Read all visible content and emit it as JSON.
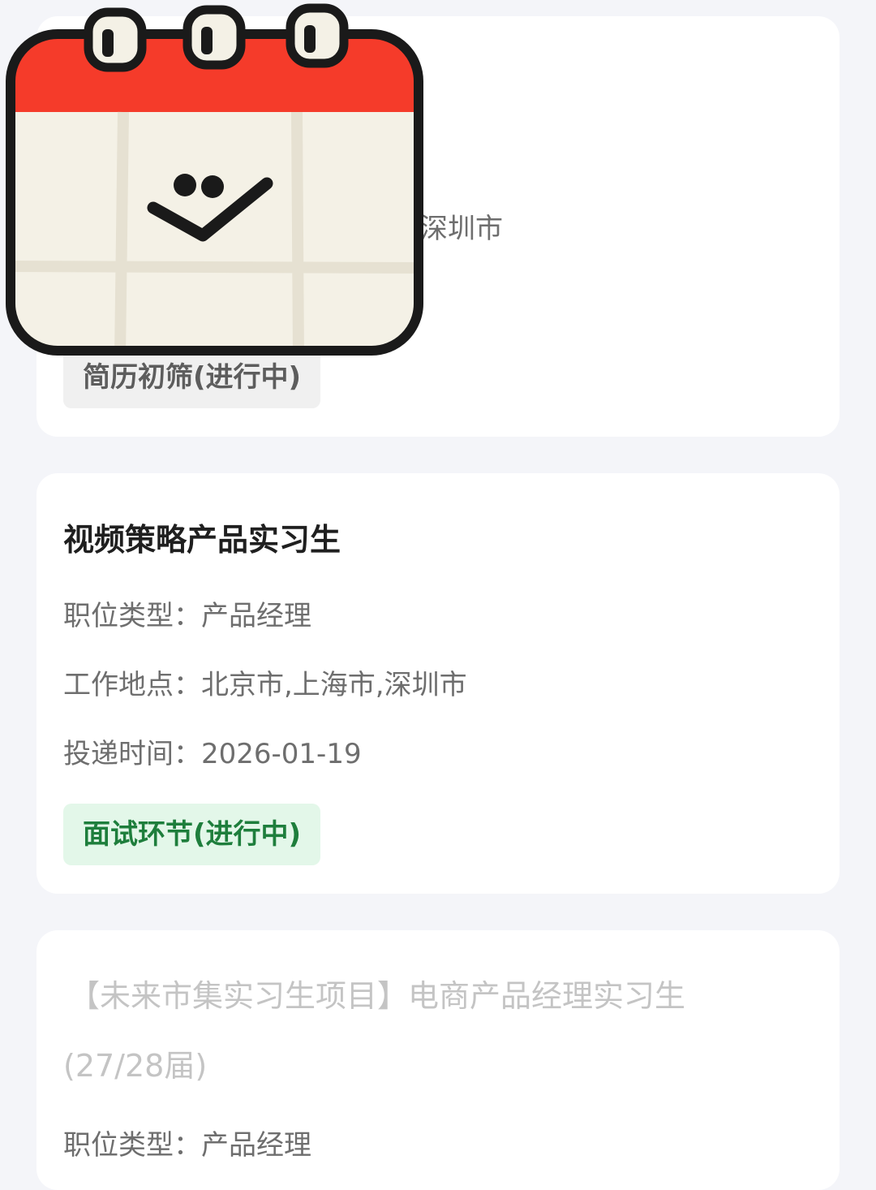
{
  "cards": [
    {
      "location_fragment": "深圳市",
      "status": "简历初筛(进行中)",
      "status_style": "gray"
    },
    {
      "title": "视频策略产品实习生",
      "job_type_label": "职位类型：",
      "job_type": "产品经理",
      "location_label": "工作地点：",
      "location": "北京市,上海市,深圳市",
      "date_label": "投递时间：",
      "date": "2026-01-19",
      "status": "面试环节(进行中)",
      "status_style": "green"
    },
    {
      "title_line1": "【未来市集实习生项目】电商产品经理实习生",
      "title_line2": "(27/28届)",
      "job_type_label": "职位类型：",
      "job_type": "产品经理"
    }
  ],
  "sticker": {
    "icon": "calendar-smiley-icon",
    "colors": {
      "header": "#f53b2a",
      "body": "#f4f1e6",
      "outline": "#1a1a1a"
    }
  }
}
